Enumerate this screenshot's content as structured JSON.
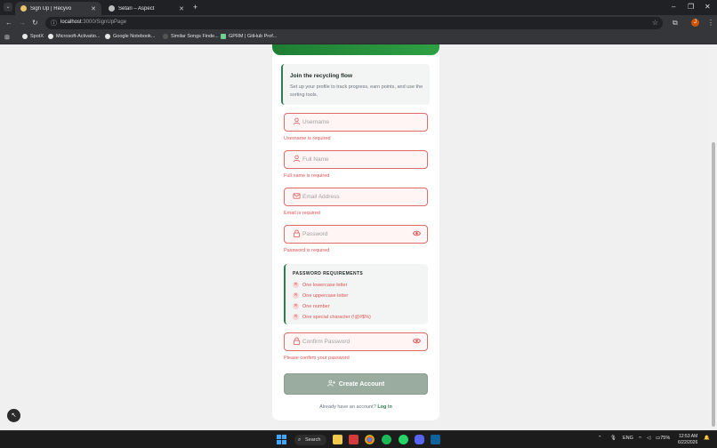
{
  "browser": {
    "tabs": [
      {
        "title": "Sign Up | Recyvo",
        "active": true
      },
      {
        "title": "Setări – Aspect",
        "active": false
      }
    ],
    "url_host": "localhost",
    "url_path": ":3000/SignUpPage",
    "bookmarks": [
      "SpotX",
      "Microsoft-Activatio...",
      "Google Notebook...",
      "Similar Songs Finde...",
      "GPRM | GitHub Prof..."
    ]
  },
  "form": {
    "intro_title": "Join the recycling flow",
    "intro_text": "Set up your profile to track progress, earn points, and use the sorting tools.",
    "username_placeholder": "Username",
    "username_error": "Username is required",
    "fullname_placeholder": "Full Name",
    "fullname_error": "Full name is required",
    "email_placeholder": "Email Address",
    "email_error": "Email is required",
    "password_placeholder": "Password",
    "password_error": "Password is required",
    "requirements_title": "PASSWORD REQUIREMENTS",
    "requirements": [
      "One lowercase letter",
      "One uppercase letter",
      "One number",
      "One special character (!@#$%)"
    ],
    "confirm_placeholder": "Confirm Password",
    "confirm_error": "Please confirm your password",
    "submit_label": "Create Account",
    "login_prompt": "Already have an account?",
    "login_link": "Log in"
  },
  "taskbar": {
    "search_label": "Search",
    "language": "ENG",
    "battery": "75%",
    "time": "12:53 AM",
    "date": "6/22/2026"
  },
  "colors": {
    "error": "#e05252",
    "accent_green": "#2e7d4f",
    "button_disabled": "#9aab9f"
  }
}
